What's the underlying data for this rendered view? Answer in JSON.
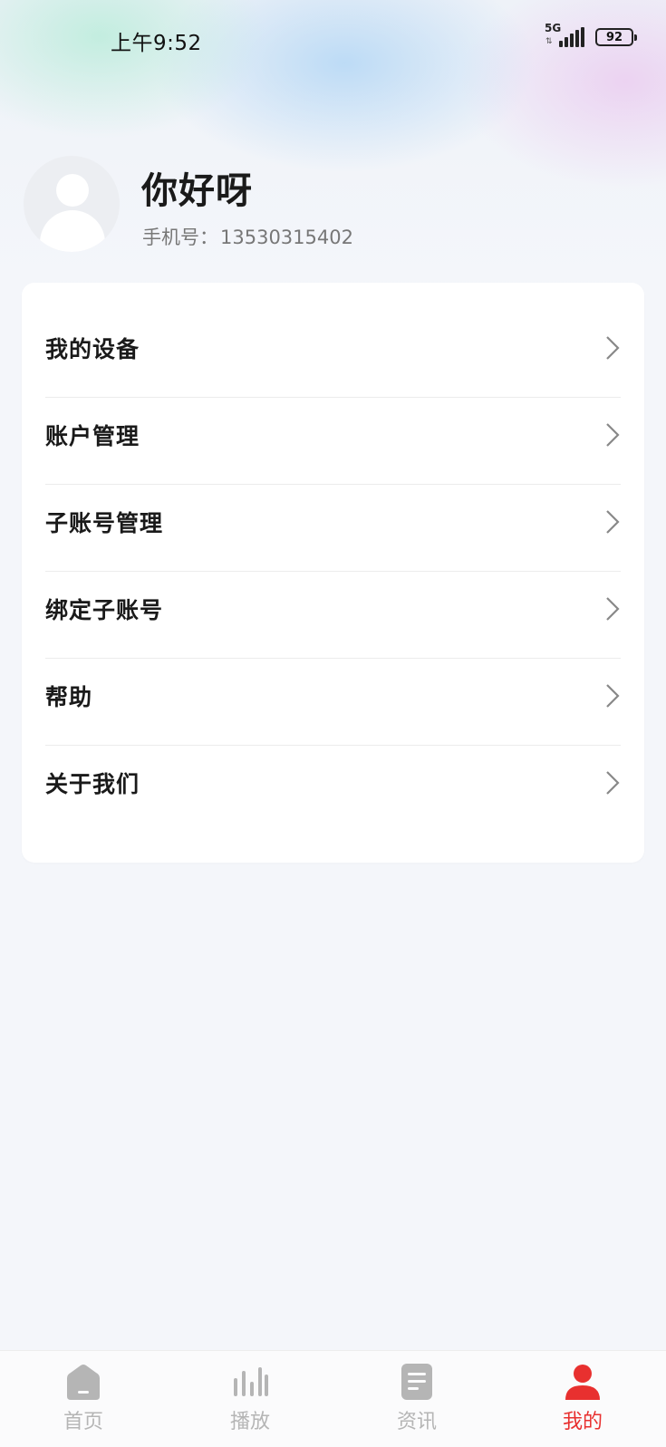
{
  "status_bar": {
    "time": "上午9:52",
    "network": "5G",
    "battery": "92"
  },
  "profile": {
    "greeting": "你好呀",
    "phone_label": "手机号：",
    "phone_number": "13530315402"
  },
  "menu": {
    "items": [
      {
        "label": "我的设备"
      },
      {
        "label": "账户管理"
      },
      {
        "label": "子账号管理"
      },
      {
        "label": "绑定子账号"
      },
      {
        "label": "帮助"
      },
      {
        "label": "关于我们"
      }
    ]
  },
  "tabbar": {
    "tabs": [
      {
        "label": "首页",
        "icon": "home-icon"
      },
      {
        "label": "播放",
        "icon": "equalizer-icon"
      },
      {
        "label": "资讯",
        "icon": "document-icon"
      },
      {
        "label": "我的",
        "icon": "user-icon"
      }
    ],
    "active_index": 3,
    "active_color": "#e8302f",
    "inactive_color": "#b5b5b5"
  }
}
